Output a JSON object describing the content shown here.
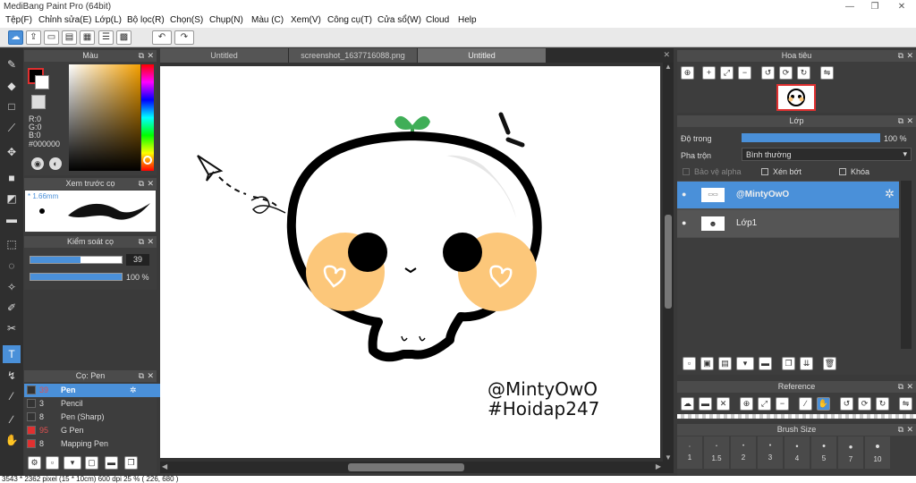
{
  "window": {
    "title": "MediBang Paint Pro (64bit)",
    "min": "—",
    "restore": "❐",
    "close": "✕"
  },
  "menu": [
    "Tệp(F)",
    "Chỉnh sửa(E)",
    "Lớp(L)",
    "Bộ lọc(R)",
    "Chọn(S)",
    "Chụp(N)",
    "Màu (C)",
    "Xem(V)",
    "Công cụ(T)",
    "Cửa sổ(W)",
    "Cloud",
    "Help"
  ],
  "toolbar": {
    "undo": "↶",
    "redo": "↷"
  },
  "color_panel": {
    "title": "Màu",
    "r": "R:0",
    "g": "G:0",
    "b": "B:0",
    "hex": "#000000",
    "accent": "#4a90d9"
  },
  "brush_preview": {
    "title": "Xem trước cọ",
    "size": "* 1.66mm"
  },
  "brush_control": {
    "title": "Kiểm soát cọ",
    "size_value": "39",
    "size_level": 0.55,
    "opacity_value": "100 %",
    "opacity_level": 1.0
  },
  "brush_list": {
    "title": "Cọ: Pen",
    "items": [
      {
        "num": "39",
        "name": "Pen",
        "color": "#333333",
        "selected": true
      },
      {
        "num": "3",
        "name": "Pencil",
        "color": "#333333"
      },
      {
        "num": "8",
        "name": "Pen (Sharp)",
        "color": "#333333"
      },
      {
        "num": "95",
        "name": "G Pen",
        "color": "#e03030"
      },
      {
        "num": "8",
        "name": "Mapping Pen",
        "color": "#e03030"
      }
    ]
  },
  "tabs": [
    "Untitled",
    "screenshot_1637716088.png",
    "Untitled"
  ],
  "artwork": {
    "handle": "@MintyOwO",
    "tag": "#Hoidap247"
  },
  "navigator": {
    "title": "Hoa tiêu"
  },
  "layers": {
    "title": "Lớp",
    "opacity_label": "Độ trong",
    "opacity_value": "100 %",
    "opacity_level": 1.0,
    "blend_label": "Pha trộn",
    "blend_value": "Bình thường",
    "protect_alpha": "Bảo vệ alpha",
    "clipping": "Xén bớt",
    "lock": "Khóa",
    "items": [
      {
        "name": "@MintyOwO",
        "selected": true
      },
      {
        "name": "Lớp1",
        "selected": false
      }
    ]
  },
  "reference": {
    "title": "Reference"
  },
  "brush_size": {
    "title": "Brush Size",
    "sizes": [
      "1",
      "1.5",
      "2",
      "3",
      "4",
      "5",
      "7",
      "10"
    ]
  },
  "status": {
    "text": "3543 * 2362 pixel  (15 * 10cm)  600 dpi  25 %  ( 226, 680 )"
  }
}
